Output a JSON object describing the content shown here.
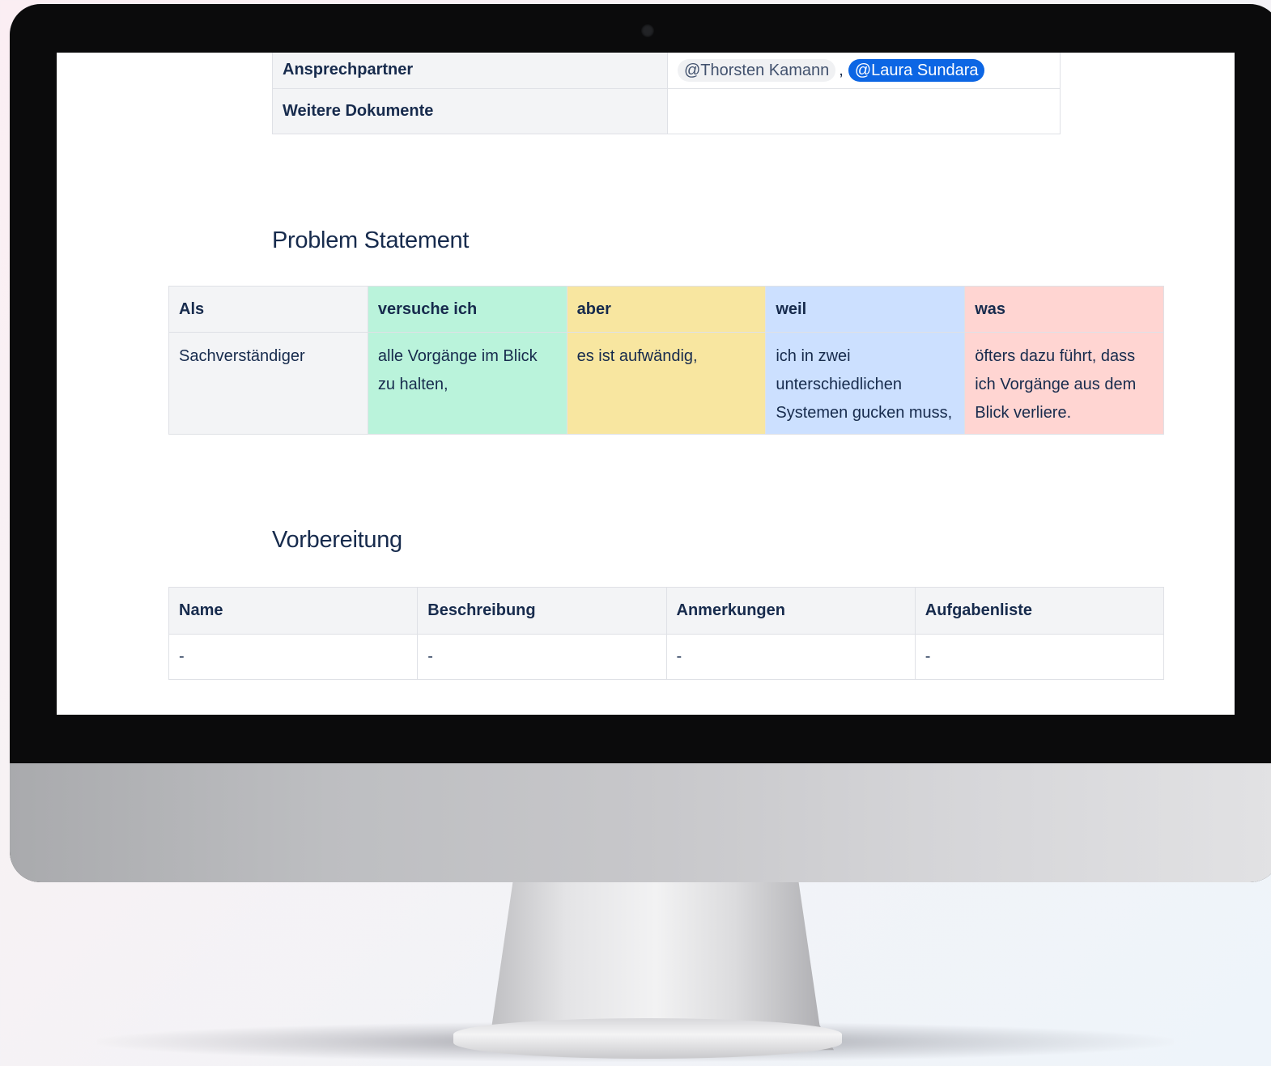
{
  "meta_table": {
    "rows": [
      {
        "label": "Ansprechpartner",
        "mentions": [
          "@Thorsten Kamann",
          "@Laura Sundara"
        ],
        "separator": ","
      },
      {
        "label": "Weitere Dokumente",
        "value": ""
      }
    ]
  },
  "problem_statement": {
    "heading": "Problem Statement",
    "columns": [
      {
        "header": "Als",
        "body": "Sachverständiger",
        "color": "#f3f4f6"
      },
      {
        "header": "versuche ich",
        "body": "alle Vorgänge im Blick zu halten,",
        "color": "#baf3db"
      },
      {
        "header": "aber",
        "body": "es ist aufwändig,",
        "color": "#f8e6a0"
      },
      {
        "header": "weil",
        "body": "ich in zwei unterschiedlichen Systemen gucken muss,",
        "color": "#cce0ff"
      },
      {
        "header": "was",
        "body": "öfters dazu führt, dass ich Vorgänge aus dem Blick verliere.",
        "color": "#ffd5d2"
      }
    ]
  },
  "vorbereitung": {
    "heading": "Vorbereitung",
    "headers": [
      "Name",
      "Beschreibung",
      "Anmerkungen",
      "Aufgabenliste"
    ],
    "row": [
      "-",
      "-",
      "-",
      "-"
    ]
  },
  "colors": {
    "mention_self": "#0c66e4",
    "text": "#172b4d"
  }
}
